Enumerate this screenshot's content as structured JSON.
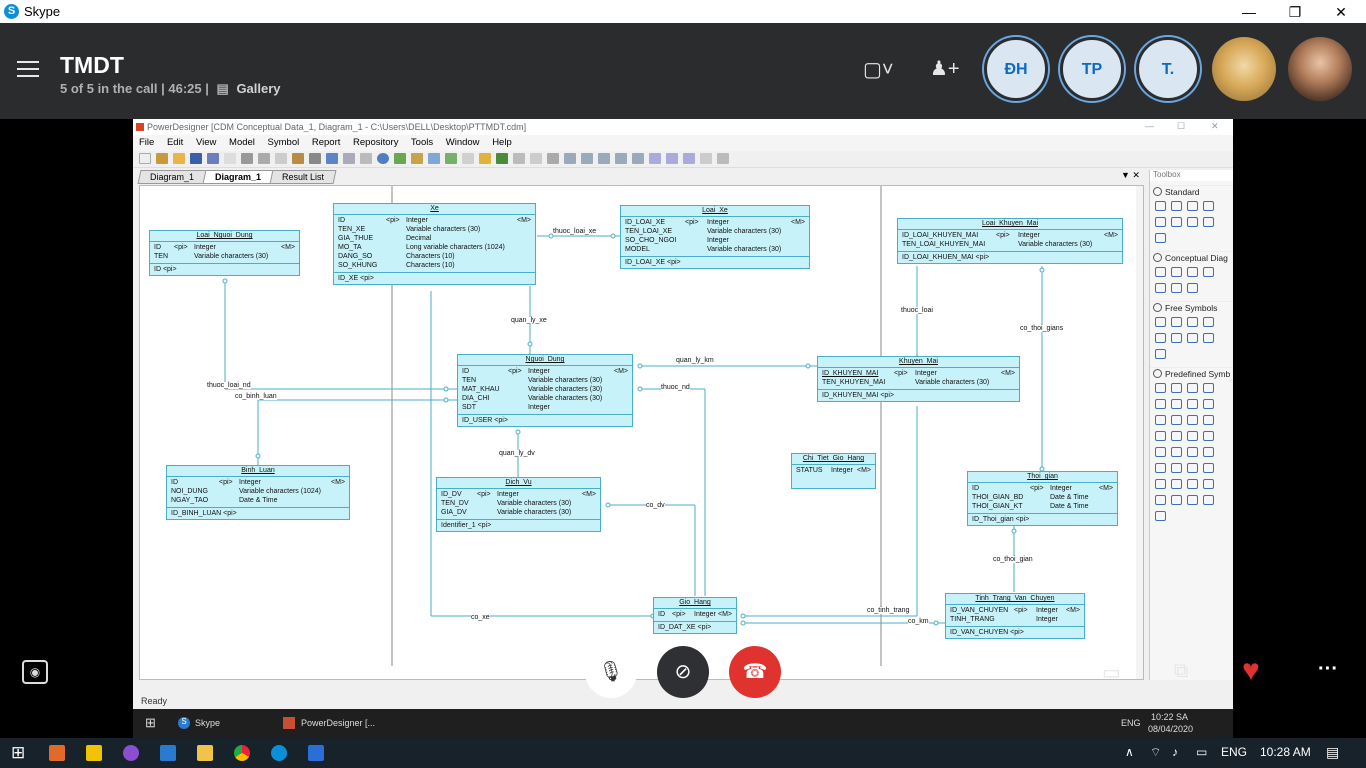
{
  "app": {
    "title": "Skype",
    "min": "—",
    "max": "❐",
    "close": "✕"
  },
  "call": {
    "title": "TMDT",
    "subtitle": "5 of 5 in the call | 46:25 |",
    "gallery": "Gallery",
    "participants": [
      "ĐH",
      "TP",
      "T."
    ]
  },
  "pd": {
    "window_title": "PowerDesigner [CDM Conceptual Data_1, Diagram_1 - C:\\Users\\DELL\\Desktop\\PTTMDT.cdm]",
    "menu": [
      "File",
      "Edit",
      "View",
      "Model",
      "Symbol",
      "Report",
      "Repository",
      "Tools",
      "Window",
      "Help"
    ],
    "tabs": [
      "Diagram_1",
      "Diagram_1",
      "Result List"
    ],
    "status": "Ready",
    "entities": {
      "loai_nguoi_dung": {
        "name": "Loai_Nguoi_Dung",
        "rows": [
          [
            "ID",
            "<pi>",
            "Integer",
            "<M>"
          ],
          [
            "TEN",
            "",
            "Variable characters (30)",
            ""
          ]
        ],
        "footer": "ID  <pi>"
      },
      "xe": {
        "name": "Xe",
        "rows": [
          [
            "ID",
            "<pi>",
            "Integer",
            "<M>"
          ],
          [
            "TEN_XE",
            "",
            "Variable characters (30)",
            ""
          ],
          [
            "GIA_THUE",
            "",
            "Decimal",
            ""
          ],
          [
            "MO_TA",
            "",
            "Long variable characters (1024)",
            ""
          ],
          [
            "DANG_SO",
            "",
            "Characters (10)",
            ""
          ],
          [
            "SO_KHUNG",
            "",
            "Characters (10)",
            ""
          ]
        ],
        "footer": "ID_XE  <pi>"
      },
      "loai_xe": {
        "name": "Loai_Xe",
        "rows": [
          [
            "ID_LOAI_XE",
            "<pi>",
            "Integer",
            "<M>"
          ],
          [
            "TEN_LOAI_XE",
            "",
            "Variable characters (30)",
            ""
          ],
          [
            "SO_CHO_NGOI",
            "",
            "Integer",
            ""
          ],
          [
            "MODEL",
            "",
            "Variable characters (30)",
            ""
          ]
        ],
        "footer": "ID_LOAI_XE  <pi>"
      },
      "loai_khuyen_mai": {
        "name": "Loai_Khuyen_Mai",
        "rows": [
          [
            "ID_LOAI_KHUYEN_MAI",
            "<pi>",
            "Integer",
            "<M>"
          ],
          [
            "TEN_LOAI_KHUYEN_MAI",
            "",
            "Variable characters (30)",
            ""
          ]
        ],
        "footer": "ID_LOAI_KHUEN_MAI  <pi>"
      },
      "nguoi_dung": {
        "name": "Nguoi_Dung",
        "rows": [
          [
            "ID",
            "<pi>",
            "Integer",
            "<M>"
          ],
          [
            "TEN",
            "",
            "Variable characters (30)",
            ""
          ],
          [
            "MAT_KHAU",
            "",
            "Variable characters (30)",
            ""
          ],
          [
            "DIA_CHI",
            "",
            "Variable characters (30)",
            ""
          ],
          [
            "SDT",
            "",
            "Integer",
            ""
          ]
        ],
        "footer": "ID_USER  <pi>"
      },
      "khuyen_mai": {
        "name": "Khuyen_Mai",
        "rows": [
          [
            "ID_KHUYEN_MAI",
            "<pi>",
            "Integer",
            "<M>"
          ],
          [
            "TEN_KHUYEN_MAI",
            "",
            "Variable characters (30)",
            ""
          ]
        ],
        "footer": "ID_KHUYEN_MAI  <pi>"
      },
      "binh_luan": {
        "name": "Binh_Luan",
        "rows": [
          [
            "ID",
            "<pi>",
            "Integer",
            "<M>"
          ],
          [
            "NOI_DUNG",
            "",
            "Variable characters (1024)",
            ""
          ],
          [
            "NGAY_TAO",
            "",
            "Date & Time",
            ""
          ]
        ],
        "footer": "ID_BINH_LUAN  <pi>"
      },
      "dich_vu": {
        "name": "Dich_Vu",
        "rows": [
          [
            "ID_DV",
            "<pi>",
            "Integer",
            "<M>"
          ],
          [
            "TEN_DV",
            "",
            "Variable characters (30)",
            ""
          ],
          [
            "GIA_DV",
            "",
            "Variable characters (30)",
            ""
          ]
        ],
        "footer": "Identifier_1  <pi>"
      },
      "chi_tiet": {
        "name": "Chi_Tiet_Gio_Hang",
        "rows": [
          [
            "STATUS",
            "",
            "Integer",
            "<M>"
          ]
        ],
        "footer": ""
      },
      "thoi_gian": {
        "name": "Thoi_gian",
        "rows": [
          [
            "ID",
            "<pi>",
            "Integer",
            "<M>"
          ],
          [
            "THOI_GIAN_BD",
            "",
            "Date & Time",
            ""
          ],
          [
            "THOI_GIAN_KT",
            "",
            "Date & Time",
            ""
          ]
        ],
        "footer": "ID_Thoi_gian  <pi>"
      },
      "gio_hang": {
        "name": "Gio_Hang",
        "rows": [
          [
            "ID",
            "<pi>",
            "Integer",
            "<M>"
          ]
        ],
        "footer": "ID_DAT_XE  <pi>"
      },
      "tinh_trang": {
        "name": "Tinh_Trang_Van_Chuyen",
        "rows": [
          [
            "ID_VAN_CHUYEN",
            "<pi>",
            "Integer",
            "<M>"
          ],
          [
            "TINH_TRANG",
            "",
            "Integer",
            ""
          ]
        ],
        "footer": "ID_VAN_CHUYEN  <pi>"
      }
    },
    "relations": {
      "thuoc_loai_xe": "thuoc_loai_xe",
      "quan_ly_xe": "quan_ly_xe",
      "thuoc_loai_nd": "thuoc_loai_nd",
      "co_binh_luan": "co_binh_luan",
      "quan_ly_km": "quan_ly_km",
      "thuoc_nd": "thuoc_nd",
      "quan_ly_dv": "quan_ly_dv",
      "co_dv": "co_dv",
      "co_xe": "co_xe",
      "co_tinh_trang": "co_tinh_trang",
      "co_km": "co_km",
      "thuoc_loai": "thuoc_loai",
      "co_thoi_gians": "co_thoi_gians",
      "co_thoi_gian": "co_thoi_gian"
    },
    "toolbox": {
      "caption": "Toolbox",
      "sections": [
        "Standard",
        "Conceptual Diag",
        "Free Symbols",
        "Predefined Symb"
      ]
    }
  },
  "inner_taskbar": {
    "skype": "Skype",
    "powerdesigner": "PowerDesigner [...",
    "lang": "ENG",
    "time": "10:22 SA",
    "date": "08/04/2020"
  },
  "taskbar": {
    "lang": "ENG",
    "time": "10:28 AM"
  }
}
